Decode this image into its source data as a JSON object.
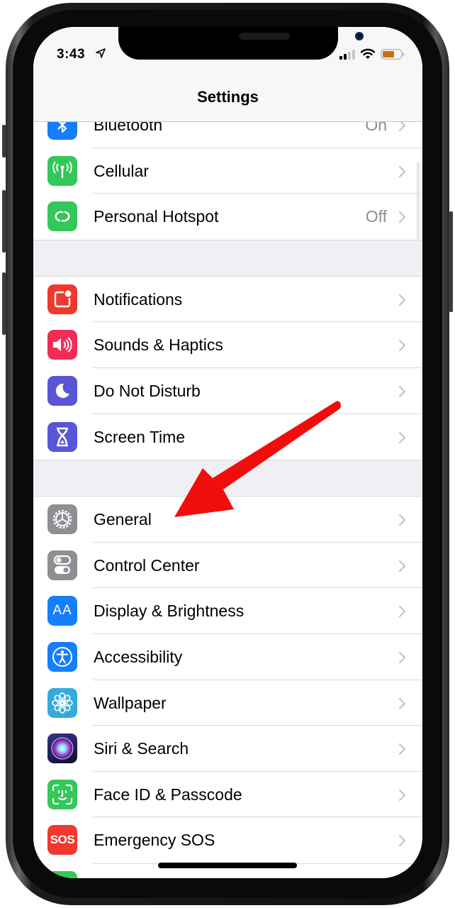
{
  "status_bar": {
    "time": "3:43",
    "location_icon": "location-arrow-icon",
    "signal_icon": "cellular-signal-icon",
    "wifi_icon": "wifi-icon",
    "battery_icon": "battery-icon",
    "battery_color": "#c8720f"
  },
  "header": {
    "title": "Settings"
  },
  "groups": [
    {
      "items": [
        {
          "label": "Bluetooth",
          "value": "On",
          "icon": "bluetooth-icon",
          "color": "#157efb"
        },
        {
          "label": "Cellular",
          "value": "",
          "icon": "cellular-antenna-icon",
          "color": "#34c759"
        },
        {
          "label": "Personal Hotspot",
          "value": "Off",
          "icon": "hotspot-link-icon",
          "color": "#34c759"
        }
      ]
    },
    {
      "items": [
        {
          "label": "Notifications",
          "value": "",
          "icon": "notifications-icon",
          "color": "#f0382e"
        },
        {
          "label": "Sounds & Haptics",
          "value": "",
          "icon": "speaker-icon",
          "color": "#f22d55"
        },
        {
          "label": "Do Not Disturb",
          "value": "",
          "icon": "moon-icon",
          "color": "#5856d6"
        },
        {
          "label": "Screen Time",
          "value": "",
          "icon": "hourglass-icon",
          "color": "#5856d6"
        }
      ]
    },
    {
      "items": [
        {
          "label": "General",
          "value": "",
          "icon": "gear-icon",
          "color": "#8e8e93"
        },
        {
          "label": "Control Center",
          "value": "",
          "icon": "toggles-icon",
          "color": "#8e8e93"
        },
        {
          "label": "Display & Brightness",
          "value": "",
          "icon": "text-size-icon",
          "color": "#157efb",
          "glyph": "AA"
        },
        {
          "label": "Accessibility",
          "value": "",
          "icon": "accessibility-icon",
          "color": "#157efb"
        },
        {
          "label": "Wallpaper",
          "value": "",
          "icon": "flower-icon",
          "color": "#35aadc"
        },
        {
          "label": "Siri & Search",
          "value": "",
          "icon": "siri-icon",
          "color": "#1b1b3a"
        },
        {
          "label": "Face ID & Passcode",
          "value": "",
          "icon": "face-id-icon",
          "color": "#34c759"
        },
        {
          "label": "Emergency SOS",
          "value": "",
          "icon": "sos-icon",
          "color": "#f0382e",
          "glyph": "SOS"
        }
      ]
    }
  ],
  "annotation": {
    "type": "arrow",
    "color": "#f20d0d",
    "points_to": "General"
  }
}
